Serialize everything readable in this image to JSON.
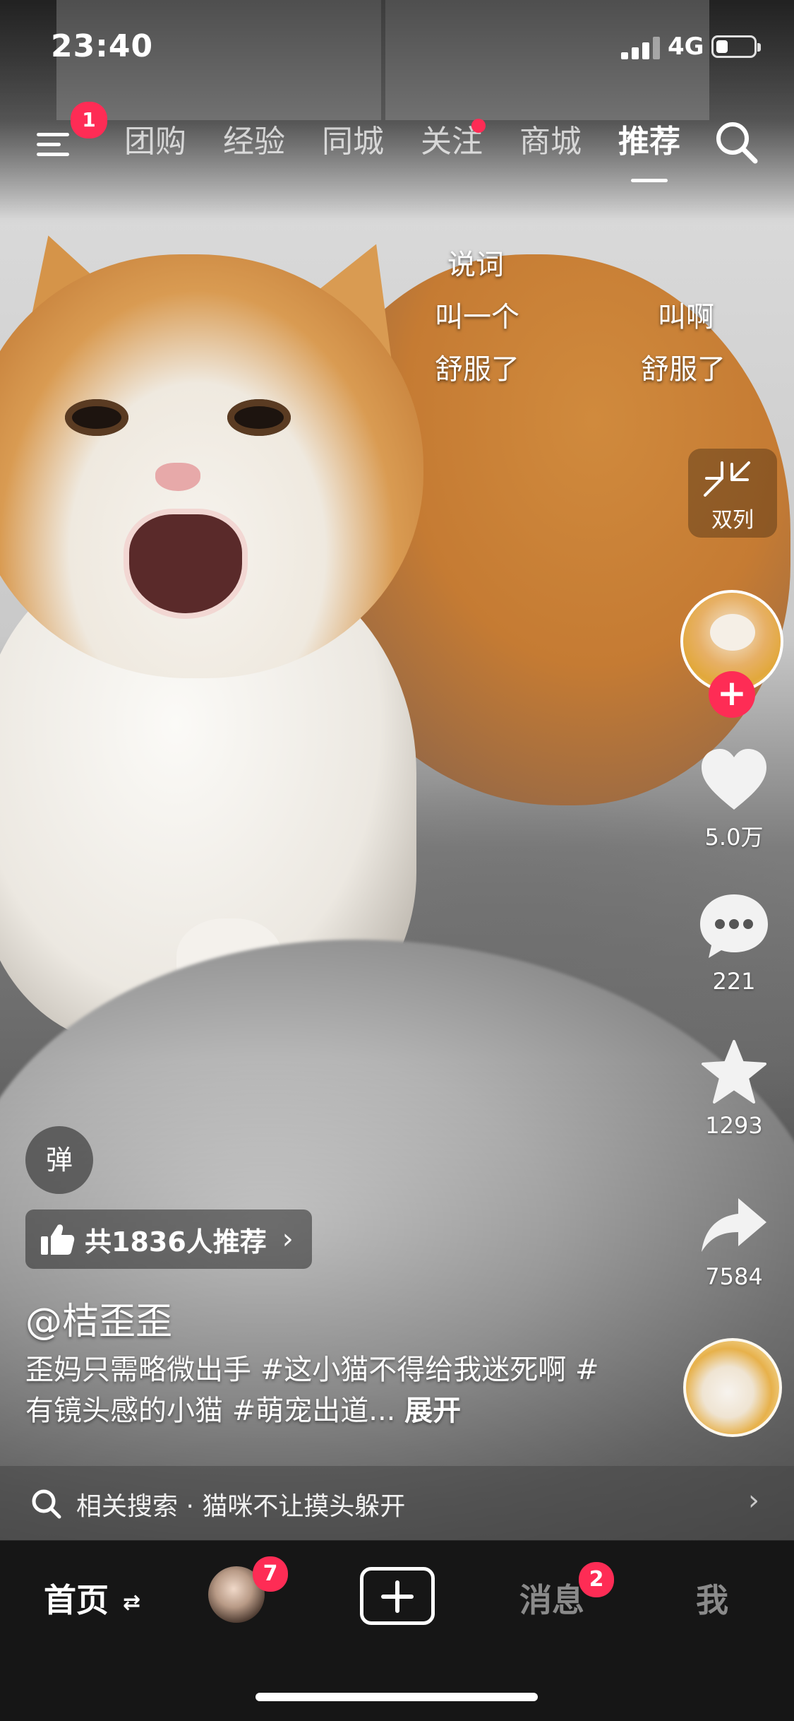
{
  "status_bar": {
    "time": "23:40",
    "network": "4G",
    "battery_level": 0.3
  },
  "top_nav": {
    "menu_badge": "1",
    "tabs": [
      {
        "label": "团购",
        "active": false,
        "dot": false
      },
      {
        "label": "经验",
        "active": false,
        "dot": false
      },
      {
        "label": "同城",
        "active": false,
        "dot": false
      },
      {
        "label": "关注",
        "active": false,
        "dot": true
      },
      {
        "label": "商城",
        "active": false,
        "dot": false
      },
      {
        "label": "推荐",
        "active": true,
        "dot": false
      }
    ],
    "search_icon": "search-icon"
  },
  "lyrics": [
    "说词",
    "叫一个",
    "叫啊",
    "舒服了",
    "舒服了"
  ],
  "right_rail": {
    "dual_column_label": "双列",
    "like_count": "5.0万",
    "comment_count": "221",
    "favorite_count": "1293",
    "share_count": "7584",
    "icons": [
      "collapse-arrows-icon",
      "heart-icon",
      "comment-icon",
      "star-icon",
      "share-icon",
      "music-disc-icon"
    ]
  },
  "video_info": {
    "danmu_label": "弹",
    "recommend_text": "共1836人推荐",
    "author": "@桔歪歪",
    "description": "歪妈只需略微出手 #这小猫不得给我迷死啊 #有镜头感的小猫 #萌宠出道...",
    "expand_label": "展开"
  },
  "related_search": {
    "text": "相关搜索 · 猫咪不让摸头躲开"
  },
  "bottom_tabs": {
    "home": "首页",
    "friends_badge": "7",
    "messages": "消息",
    "messages_badge": "2",
    "me": "我"
  },
  "colors": {
    "accent": "#fe2c55",
    "tabbar": "#161616"
  }
}
